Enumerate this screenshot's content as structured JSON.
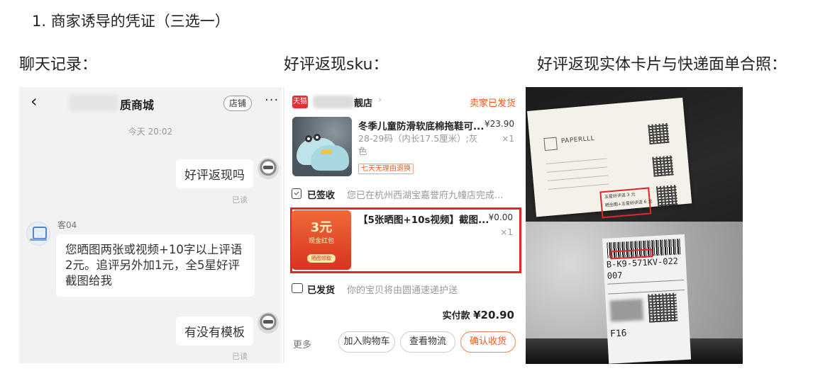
{
  "heading": "1. 商家诱导的凭证（三选一）",
  "sections": {
    "chat": "聊天记录：",
    "sku": "好评返现sku：",
    "photo": "好评返现实体卡片与快递面单合照："
  },
  "chat": {
    "back_icon": "‹",
    "shop_title": "质商城",
    "shop_button": "店铺",
    "more_icon": "···",
    "time": "今天  20:02",
    "msg1": "好评返现吗",
    "read1": "已读",
    "sender": "客04",
    "msg2": "您晒图两张或视频+10字以上评语2元。追评另外加1元，全5星好评截图给我",
    "msg3": "有没有模板",
    "read2": "已读"
  },
  "order": {
    "tmall_logo": "天猫",
    "shop_name": "靓店",
    "shop_arrow": "›",
    "status": "卖家已发货",
    "item1": {
      "title": "冬季儿童防滑软底棉拖鞋可...",
      "price": "¥23.90",
      "spec": "28-29码（内长17.5厘米）;灰色",
      "qty": "×1",
      "tag": "七天无理由退换"
    },
    "sign_label": "已签收",
    "sign_text": "您已在杭州西湖宝嘉誉府九幢店完成...",
    "item2": {
      "title": "【5张晒图+10s视频】截图...",
      "price": "¥0.00",
      "qty": "×1",
      "packet_amount": "3元",
      "packet_sub": "现金红包",
      "packet_btn": "晒图领取"
    },
    "ship_label": "已发货",
    "ship_text": "你的宝贝将由圆通速递护送",
    "total_label": "实付款 ",
    "total_value": "¥20.90",
    "more": "更多",
    "btn_cart": "加入购物车",
    "btn_logistics": "查看物流",
    "btn_confirm": "确认收货"
  },
  "photo": {
    "card_brand": "PAPERLLL",
    "card_hl1": "五星好评送 3 元",
    "card_hl2": "晒全图+五星好评送 6 元",
    "waybill_code": "B-K9-571KV-022",
    "waybill_small": "007",
    "waybill_f16": "F16"
  }
}
